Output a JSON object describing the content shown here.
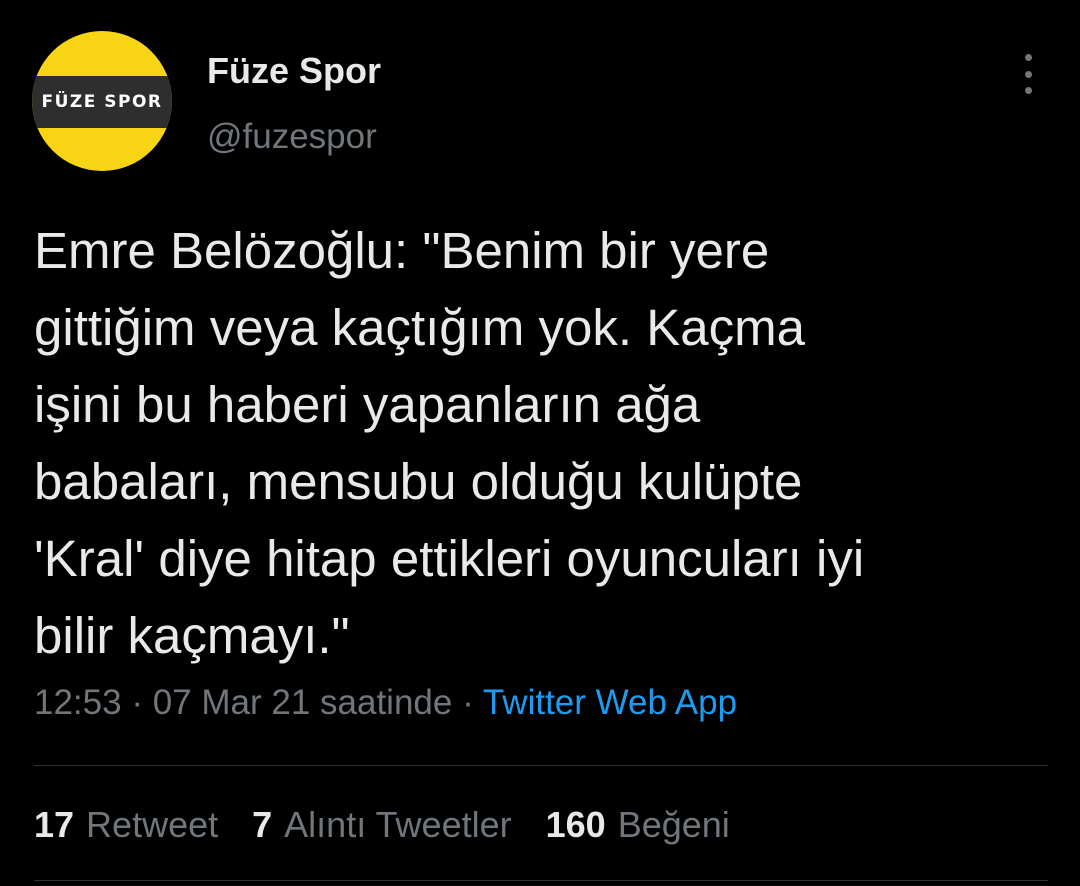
{
  "author": {
    "avatar_text": "FÜZE SPOR",
    "display_name": "Füze Spor",
    "handle": "@fuzespor"
  },
  "tweet": {
    "text": "Emre Belözoğlu: \"Benim bir yere\ngittiğim veya kaçtığım yok. Kaçma\nişini bu haberi yapanların ağa\nbabaları, mensubu olduğu kulüpte\n'Kral' diye hitap ettikleri oyuncuları iyi\nbilir kaçmayı.\"",
    "time": "12:53",
    "separator": "·",
    "date": "07 Mar 21 saatinde",
    "source": "Twitter Web App"
  },
  "stats": {
    "retweets": {
      "count": "17",
      "label": "Retweet"
    },
    "quotes": {
      "count": "7",
      "label": "Alıntı Tweetler"
    },
    "likes": {
      "count": "160",
      "label": "Beğeni"
    }
  },
  "icons": {
    "more": "more-vertical-icon"
  },
  "colors": {
    "background": "#000000",
    "primary_text": "#e7e9ea",
    "secondary_text": "#71767b",
    "link": "#1d9bf0",
    "avatar_yellow": "#f8d514",
    "avatar_band": "#2e2e2e"
  }
}
